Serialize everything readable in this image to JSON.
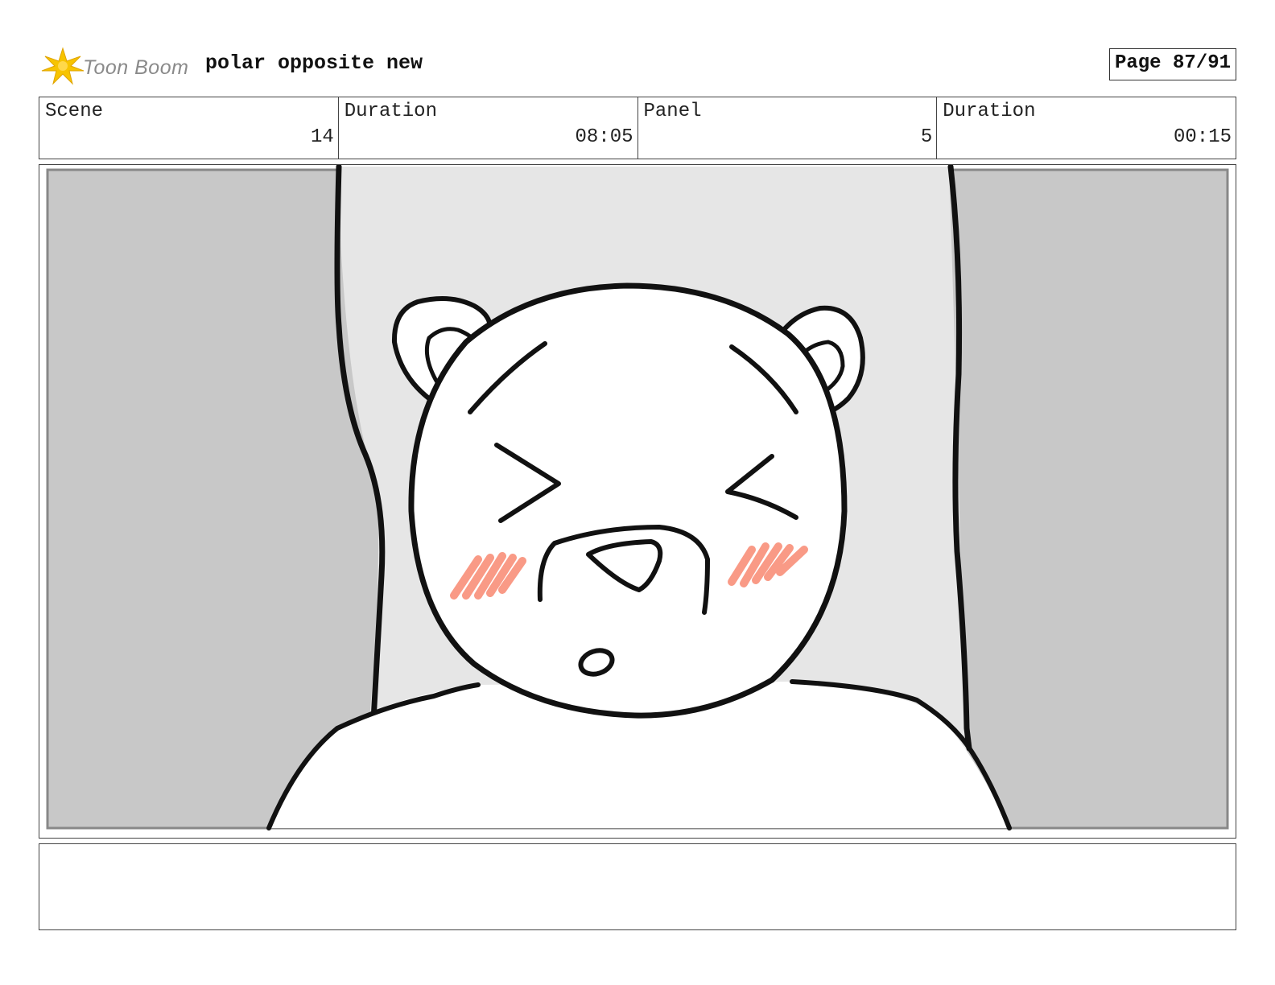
{
  "header": {
    "brand": "Toon Boom",
    "title": "polar opposite new",
    "page": "Page 87/91"
  },
  "info": {
    "scene_label": "Scene",
    "scene_value": "14",
    "scene_duration_label": "Duration",
    "scene_duration_value": "08:05",
    "panel_label": "Panel",
    "panel_value": "5",
    "panel_duration_label": "Duration",
    "panel_duration_value": "00:15"
  },
  "panel_art": {
    "icon": "polar-bear-sketch",
    "colors": {
      "wall": "#c8c8c8",
      "backdrop": "#e6e6e6",
      "blush": "#f99a86",
      "ink": "#111111"
    }
  },
  "notes": {
    "text": ""
  },
  "colors": {
    "logo_star": "#f7c400",
    "border": "#444444"
  }
}
